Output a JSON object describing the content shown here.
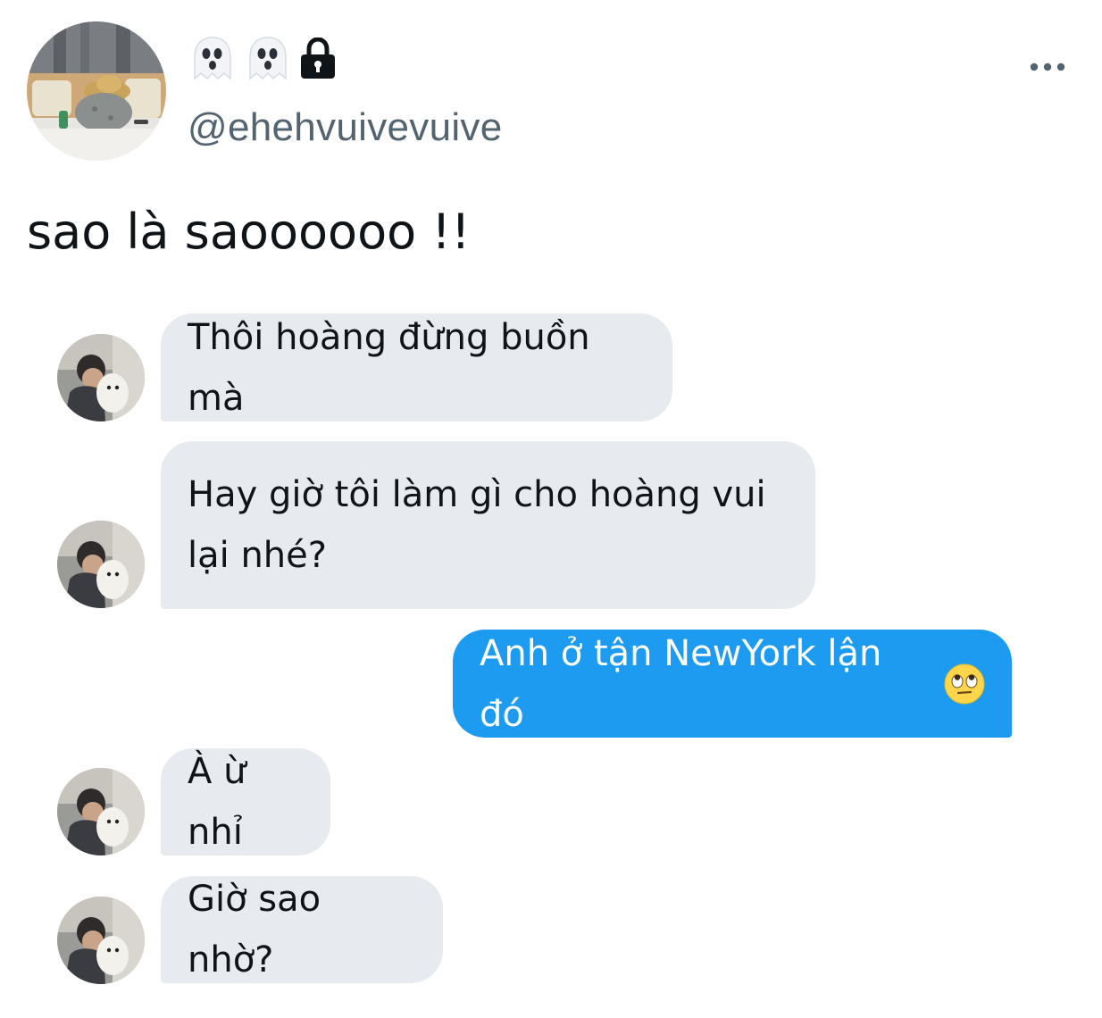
{
  "author": {
    "handle": "@ehehvuivevuive",
    "name_icons": [
      "ghost-icon",
      "ghost-icon",
      "lock-icon"
    ]
  },
  "tweet": {
    "text": "sao là saoooooo !!"
  },
  "messages": [
    {
      "sender": "other",
      "text": "Thôi hoàng đừng buồn mà"
    },
    {
      "sender": "other",
      "text": "Hay giờ tôi làm gì cho hoàng vui lại nhé?"
    },
    {
      "sender": "me",
      "text": "Anh ở tận NewYork lận đó",
      "emoji": "face-with-rolling-eyes-icon"
    },
    {
      "sender": "other",
      "text": "À ừ nhỉ"
    },
    {
      "sender": "other",
      "text": "Giờ sao nhờ?"
    }
  ],
  "colors": {
    "handle": "#536471",
    "bubble_other": "#e7ebf0",
    "bubble_me": "#1d9bf0"
  }
}
